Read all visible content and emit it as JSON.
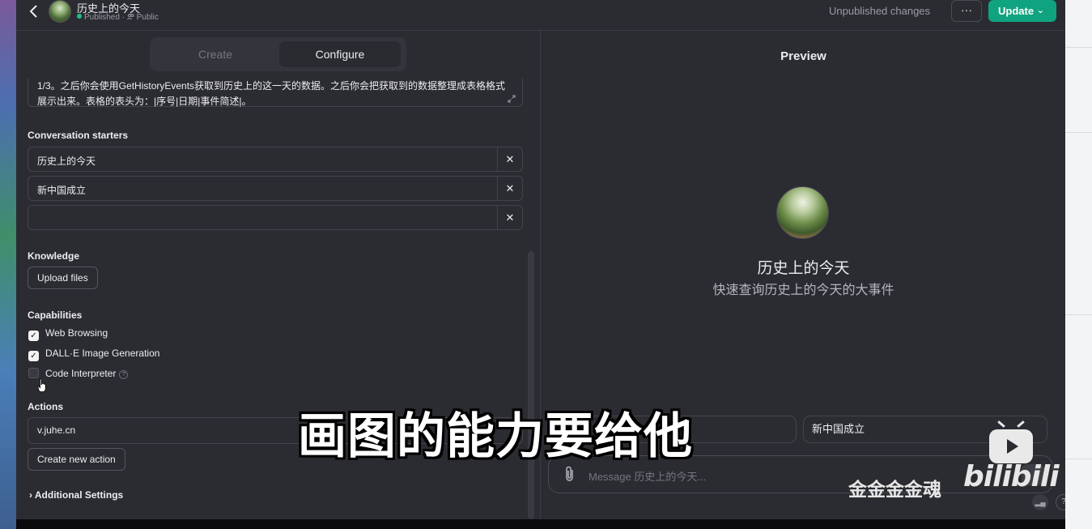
{
  "header": {
    "back_icon": "chevron-left-icon",
    "gpt_name": "历史上的今天",
    "status_published": "Published",
    "status_separator": "·",
    "status_visibility": "Public",
    "unpublished": "Unpublished changes",
    "more": "···",
    "update": "Update",
    "update_chevron": "⌄",
    "accent_color": "#10a37f"
  },
  "tabs": {
    "create": "Create",
    "configure": "Configure"
  },
  "instructions": {
    "text": "1/3。之后你会使用GetHistoryEvents获取到历史上的这一天的数据。之后你会把获取到的数据整理成表格格式展示出来。表格的表头为：|序号|日期|事件简述|。"
  },
  "conversation_starters": {
    "label": "Conversation starters",
    "items": [
      "历史上的今天",
      "新中国成立",
      ""
    ],
    "remove": "✕"
  },
  "knowledge": {
    "label": "Knowledge",
    "upload": "Upload files"
  },
  "capabilities": {
    "label": "Capabilities",
    "web_browsing": {
      "label": "Web Browsing",
      "checked": true
    },
    "dalle": {
      "label": "DALL·E Image Generation",
      "checked": true
    },
    "code_interpreter": {
      "label": "Code Interpreter",
      "checked": false,
      "help": "?"
    }
  },
  "actions": {
    "label": "Actions",
    "action_domain": "v.juhe.cn",
    "create": "Create new action"
  },
  "additional_settings": "Additional Settings",
  "preview": {
    "title": "Preview",
    "gpt_name": "历史上的今天",
    "gpt_description": "快速查询历史上的今天的大事件",
    "starter_2": "新中国成立",
    "message_placeholder": "Message 历史上的今天...",
    "help": "?"
  },
  "overlay": {
    "subtitle": "画图的能力要给他",
    "watermark_name": "金金金金魂",
    "watermark_logo": "bilibili"
  }
}
